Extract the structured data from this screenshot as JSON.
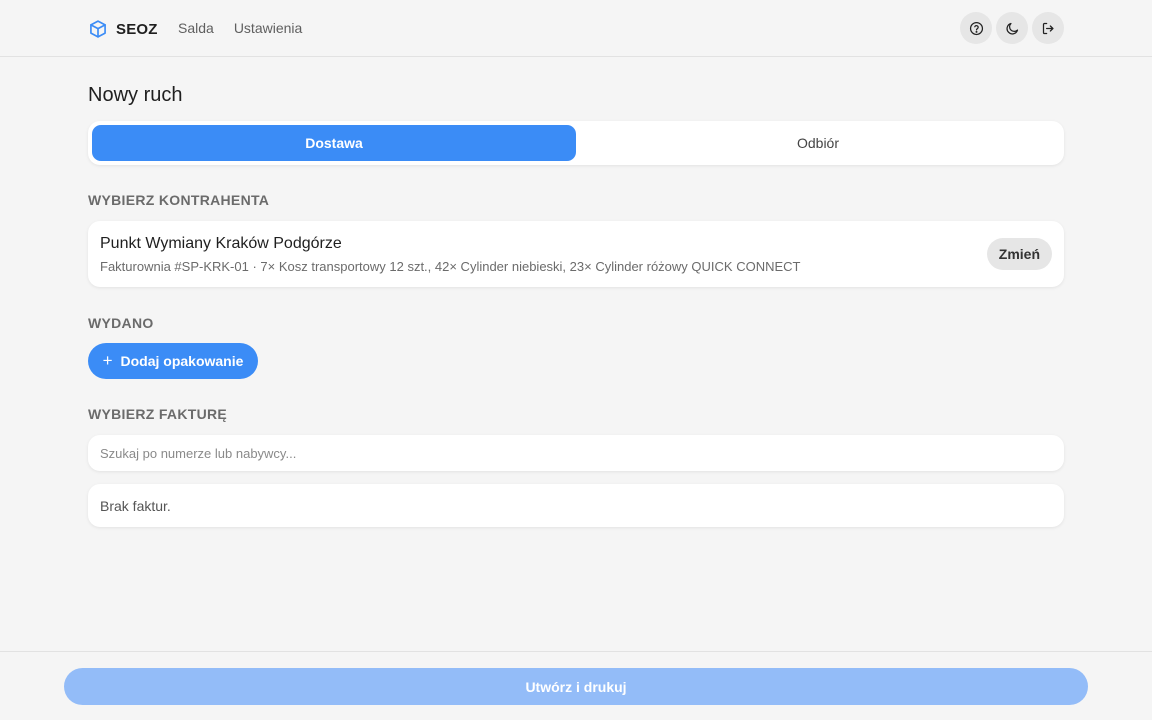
{
  "app": {
    "name": "SEOZ",
    "logo_icon": "cube-icon",
    "accent_color": "#3b8cf6"
  },
  "nav": {
    "items": [
      {
        "label": "Salda"
      },
      {
        "label": "Ustawienia"
      }
    ]
  },
  "header_actions": {
    "help_icon": "help-circle-icon",
    "theme_icon": "moon-icon",
    "logout_icon": "logout-icon"
  },
  "page": {
    "title": "Nowy ruch"
  },
  "direction_tabs": {
    "selected": "Dostawa",
    "items": [
      {
        "label": "Dostawa"
      },
      {
        "label": "Odbiór"
      }
    ]
  },
  "contractor_section": {
    "label": "WYBIERZ KONTRAHENTA",
    "name": "Punkt Wymiany Kraków Podgórze",
    "description": "Fakturownia #SP-KRK-01 · 7× Kosz transportowy 12 szt., 42× Cylinder niebieski, 23× Cylinder różowy QUICK CONNECT",
    "change_label": "Zmień"
  },
  "issued_section": {
    "label": "WYDANO",
    "add_label": "Dodaj opakowanie"
  },
  "invoice_section": {
    "label": "WYBIERZ FAKTURĘ",
    "search_placeholder": "Szukaj po numerze lub nabywcy...",
    "search_value": "",
    "empty_text": "Brak faktur."
  },
  "footer": {
    "submit_label": "Utwórz i drukuj",
    "submit_color": "#93bcf8"
  }
}
